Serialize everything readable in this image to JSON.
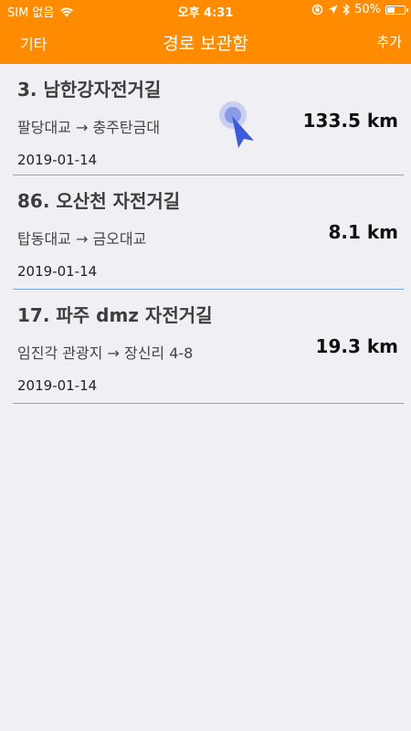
{
  "status_bar": {
    "carrier": "SIM 없음",
    "time": "오후 4:31",
    "battery_text": "50%",
    "battery_level": 0.5
  },
  "nav": {
    "left_label": "기타",
    "title": "경로 보관함",
    "right_label": "추가"
  },
  "routes": [
    {
      "name": "3. 남한강자전거길",
      "path": "팔당대교 → 충주탄금대",
      "distance": "133.5 km",
      "date": "2019-01-14"
    },
    {
      "name": "86. 오산천 자전거길",
      "path": "탑동대교 → 금오대교",
      "distance": "8.1 km",
      "date": "2019-01-14"
    },
    {
      "name": "17. 파주 dmz 자전거길",
      "path": "임진각 관광지 → 장신리 4-8",
      "distance": "19.3 km",
      "date": "2019-01-14"
    }
  ],
  "colors": {
    "header": "#ff8c00",
    "background": "#efeff4",
    "divider": "#7ea7e6",
    "pointer": "#3c5bd8"
  }
}
